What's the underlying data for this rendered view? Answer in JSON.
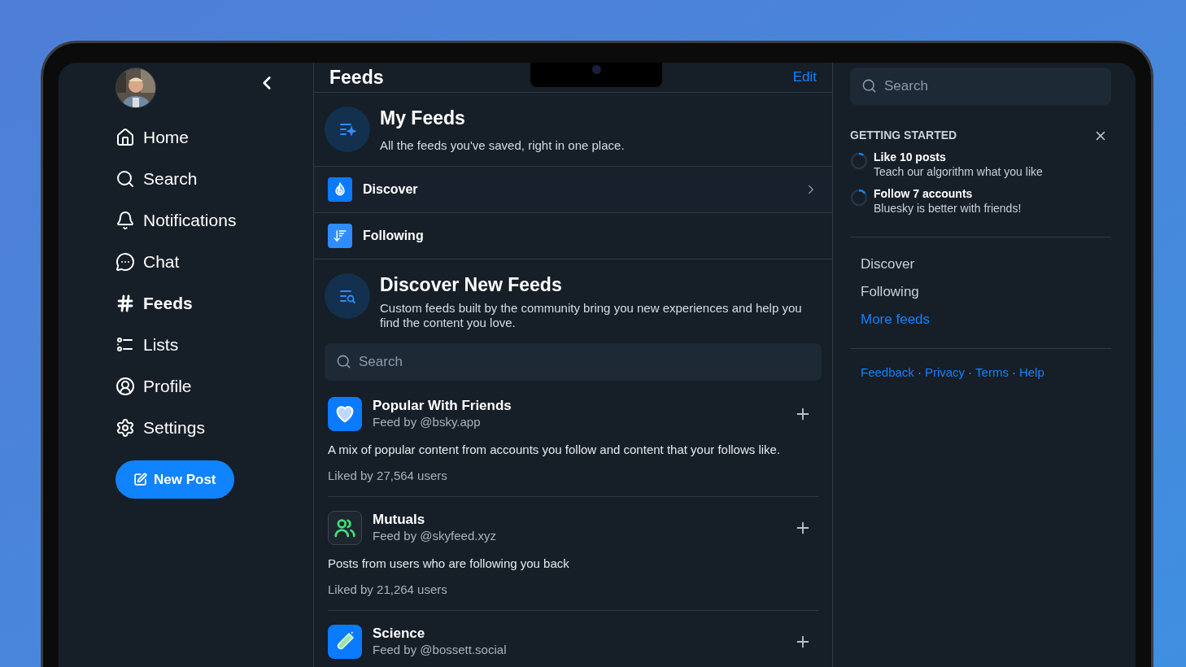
{
  "sidebar": {
    "nav": [
      {
        "label": "Home",
        "selected": false
      },
      {
        "label": "Search",
        "selected": false
      },
      {
        "label": "Notifications",
        "selected": false
      },
      {
        "label": "Chat",
        "selected": false
      },
      {
        "label": "Feeds",
        "selected": true
      },
      {
        "label": "Lists",
        "selected": false
      },
      {
        "label": "Profile",
        "selected": false
      },
      {
        "label": "Settings",
        "selected": false
      }
    ],
    "new_post": "New Post"
  },
  "header": {
    "title": "Feeds",
    "edit": "Edit"
  },
  "my_feeds": {
    "title": "My Feeds",
    "subtitle": "All the feeds you've saved, right in one place.",
    "items": [
      {
        "label": "Discover",
        "kind": "flame",
        "hovered": true
      },
      {
        "label": "Following",
        "kind": "sort",
        "hovered": false
      }
    ]
  },
  "discover_new": {
    "title": "Discover New Feeds",
    "subtitle": "Custom feeds built by the community bring you new experiences and help you find the content you love.",
    "search": {
      "placeholder": "Search"
    },
    "feeds": [
      {
        "kind": "heart",
        "name": "Popular With Friends",
        "by": "Feed by @bsky.app",
        "description": "A mix of popular content from accounts you follow and content that your follows like.",
        "likes": "Liked by 27,564 users"
      },
      {
        "kind": "people",
        "name": "Mutuals",
        "by": "Feed by @skyfeed.xyz",
        "description": "Posts from users who are following you back",
        "likes": "Liked by 21,264 users"
      },
      {
        "kind": "tube",
        "name": "Science",
        "by": "Feed by @bossett.social"
      }
    ]
  },
  "right": {
    "search": {
      "placeholder": "Search"
    },
    "getting_started": {
      "title": "GETTING STARTED",
      "tasks": [
        {
          "title": "Like 10 posts",
          "subtitle": "Teach our algorithm what you like"
        },
        {
          "title": "Follow 7 accounts",
          "subtitle": "Bluesky is better with friends!"
        }
      ]
    },
    "feed_links": [
      {
        "label": "Discover",
        "kind": "plain"
      },
      {
        "label": "Following",
        "kind": "plain"
      },
      {
        "label": "More feeds",
        "kind": "link"
      }
    ],
    "footer_links": [
      {
        "text": "Feedback",
        "kind": "link"
      },
      {
        "text": "·",
        "kind": "separator"
      },
      {
        "text": "Privacy",
        "kind": "link"
      },
      {
        "text": "·",
        "kind": "separator"
      },
      {
        "text": "Terms",
        "kind": "link"
      },
      {
        "text": "·",
        "kind": "separator"
      },
      {
        "text": "Help",
        "kind": "link"
      }
    ]
  }
}
